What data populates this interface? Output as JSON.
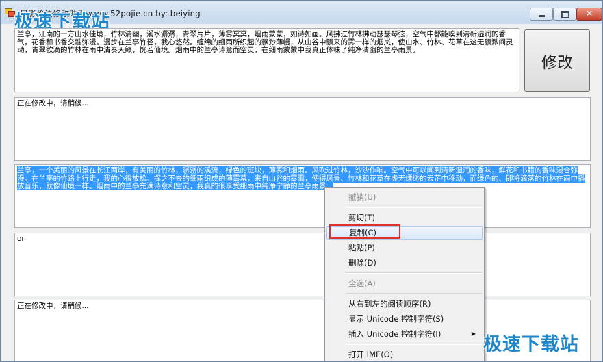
{
  "window": {
    "title": "只影论语修改助手 www.52pojie.cn by: beiying",
    "controls": {
      "minimize": "minimize",
      "maximize": "maximize",
      "close": "✕"
    }
  },
  "watermark": "极速下载站",
  "boxes": {
    "box1": "兰亭，江南的一方山水佳境，竹林清幽，溪水潺潺，青翠片片，薄雾冥冥，烟雨蒙蒙，如诗如画。风拂过竹林拂动瑟瑟琴弦，空气中都能嗅到清新湿润的香气，花香和书香交融弥漫。漫步在兰亭竹径，我心悠然。缠绵的细雨所织起的飘渺薄幔，从山谷中飘来的雾一样的烟岚，使山水、竹林、花草在这无飘渺间灵动，青翠欲滴的竹林在雨中清奏天籁，恍若仙境。烟雨中的兰亭诗意而空灵，在细雨蒙蒙中我真正体味了纯净清幽的兰亭雨景。",
    "box2": "正在修改中，请稍候...",
    "box3": "兰亭，一个美丽的风景在长江南岸，有美丽的竹林，潺潺的溪流，绿色的斑块，薄雾和烟雨。风吹过竹林，沙沙作响。空气中可以闻到清新湿润的香味，鲜花和书籍的香味混合弥漫。在兰亭的竹路上行走，我的心很放松。挥之不去的细雨织成的薄雾幕，来自山谷的雾霭，使得风景、竹林和花草在虚无缥缈的云芷中移动，而绿色的、即将滴落的竹林在雨中播放音乐，就像仙境一样。烟雨中的兰亭充满诗意和空灵，我真的很享受细雨中纯净宁静的兰亭雨景。",
    "box4": "or",
    "box5": "正在修改中，请稍候..."
  },
  "modify_button": "修改",
  "context_menu": {
    "undo": "撤销(U)",
    "cut": "剪切(T)",
    "copy": "复制(C)",
    "paste": "粘贴(P)",
    "delete": "删除(D)",
    "select_all": "全选(A)",
    "rtl": "从右到左的阅读顺序(R)",
    "show_unicode": "显示 Unicode 控制字符(S)",
    "insert_unicode": "插入 Unicode 控制字符(I)",
    "open_ime": "打开 IME(O)",
    "submenu_arrow": "▶"
  }
}
